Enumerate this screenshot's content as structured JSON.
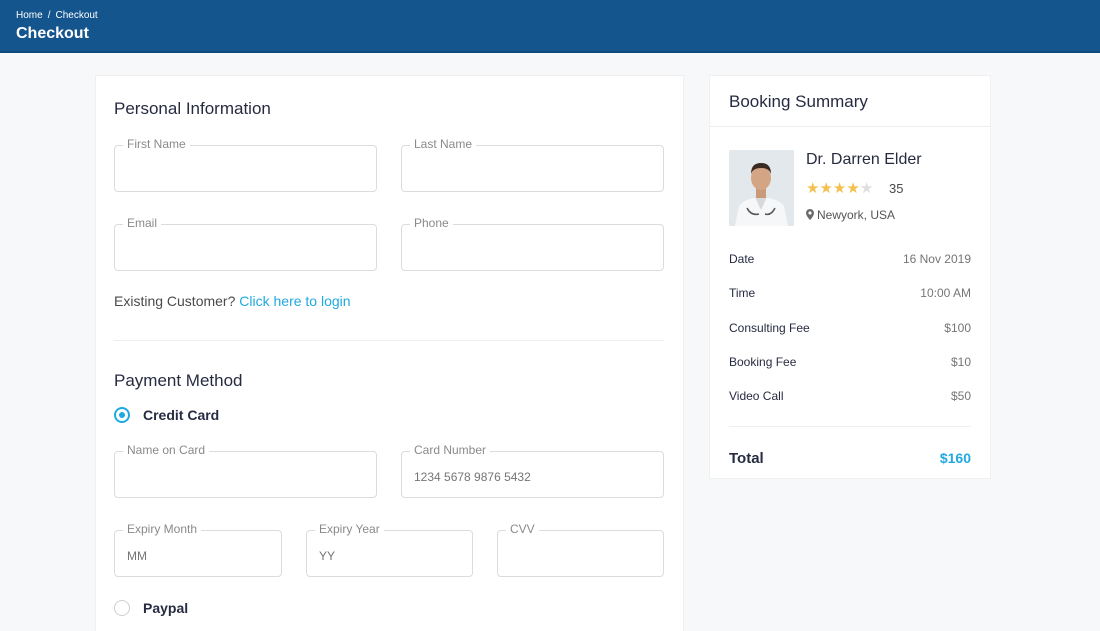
{
  "header": {
    "breadcrumb": [
      "Home",
      "/",
      "Checkout"
    ],
    "title": "Checkout",
    "bg_color": "#15558d"
  },
  "personal": {
    "title": "Personal Information",
    "first_name_label": "First Name",
    "last_name_label": "Last Name",
    "email_label": "Email",
    "phone_label": "Phone",
    "existing_text": "Existing Customer?",
    "login_link": "Click here to login"
  },
  "payment": {
    "title": "Payment Method",
    "credit_card_label": "Credit Card",
    "credit_card_selected": true,
    "name_on_card_label": "Name on Card",
    "card_number_label": "Card Number",
    "card_number_value": "1234  5678  9876  5432",
    "expiry_month_label": "Expiry Month",
    "expiry_month_value": "MM",
    "expiry_year_label": "Expiry Year",
    "expiry_year_value": "YY",
    "cvv_label": "CVV",
    "paypal_label": "Paypal",
    "paypal_selected": false
  },
  "summary": {
    "title": "Booking Summary",
    "doctor_name": "Dr. Darren Elder",
    "rating_stars": 4,
    "rating_max": 5,
    "rating_count": "35",
    "location": "Newyork, USA",
    "rows": [
      {
        "label": "Date",
        "value": "16 Nov 2019"
      },
      {
        "label": "Time",
        "value": "10:00 AM"
      },
      {
        "label": "Consulting Fee",
        "value": "$100"
      },
      {
        "label": "Booking Fee",
        "value": "$10"
      },
      {
        "label": "Video Call",
        "value": "$50"
      }
    ],
    "total_label": "Total",
    "total_value": "$160",
    "accent_color": "#20a9e1"
  }
}
